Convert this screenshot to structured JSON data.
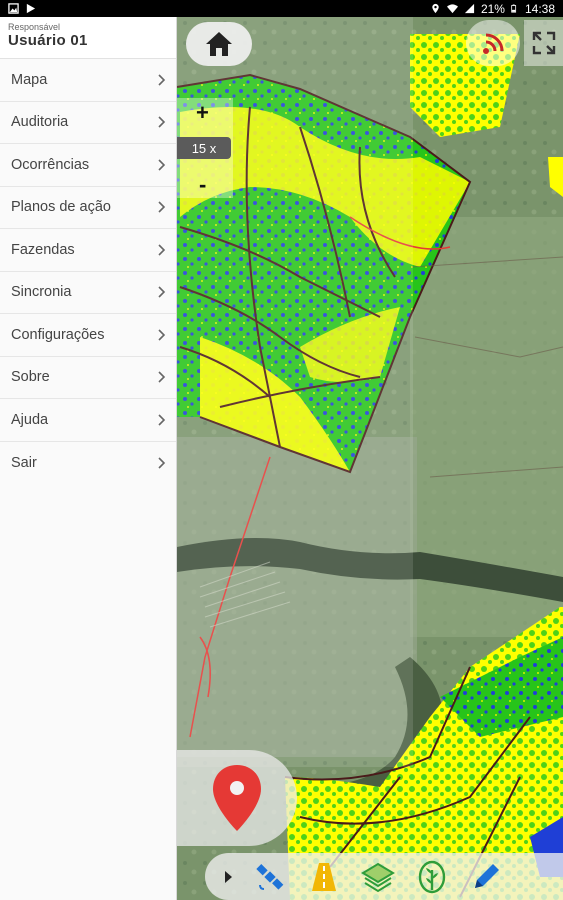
{
  "statusbar": {
    "battery": "21%",
    "time": "14:38"
  },
  "drawer": {
    "header": {
      "responsible_label": "Responsável",
      "user_name": "Usuário 01"
    },
    "items": [
      {
        "label": "Mapa"
      },
      {
        "label": "Auditoria"
      },
      {
        "label": "Ocorrências"
      },
      {
        "label": "Planos de ação"
      },
      {
        "label": "Fazendas"
      },
      {
        "label": "Sincronia"
      },
      {
        "label": "Configurações"
      },
      {
        "label": "Sobre"
      },
      {
        "label": "Ajuda"
      },
      {
        "label": "Sair"
      }
    ]
  },
  "map": {
    "zoom_in": "+",
    "zoom_out": "-",
    "zoom_level": "15 x"
  },
  "colors": {
    "accent_red": "#e53935",
    "signal_red": "#c62828",
    "toolbar_blue": "#1e73d8",
    "toolbar_green": "#2e9d3a",
    "toolbar_yellow": "#f2b705"
  },
  "icons": {
    "home": "home-icon",
    "signal": "signal-icon",
    "expand": "expand-icon",
    "pin": "location-pin-icon",
    "satellite": "satellite-icon",
    "road": "road-icon",
    "layers": "layers-icon",
    "crop": "crop-icon",
    "pencil": "pencil-icon"
  }
}
